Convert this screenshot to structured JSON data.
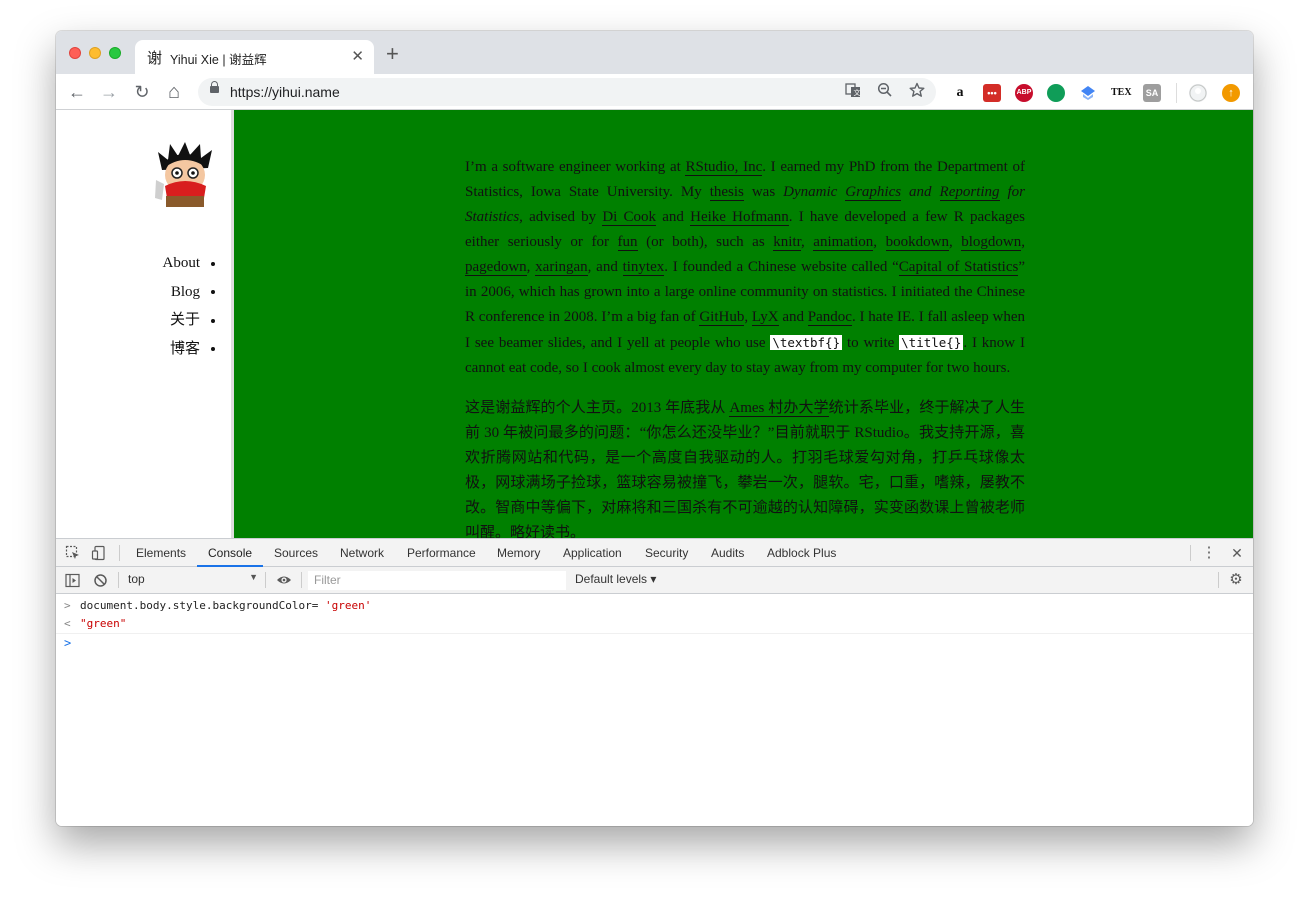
{
  "browser": {
    "tab": {
      "favicon_char": "谢",
      "title": "Yihui Xie | 谢益辉",
      "close": "✕"
    },
    "new_tab": "+",
    "url": "https://yihui.name",
    "nav": {
      "back": "←",
      "forward": "→",
      "reload": "↻",
      "home": "⌂"
    },
    "omnibox_icons": [
      "translate-icon",
      "zoom-out-icon",
      "star-icon"
    ],
    "extensions": [
      {
        "name": "amazon-icon",
        "label": "a",
        "color": "#ffffff"
      },
      {
        "name": "lastpass-icon",
        "label": "•••",
        "color": "#d32d27"
      },
      {
        "name": "adblock-plus-icon",
        "label": "ABP",
        "color": "#c70d2c"
      },
      {
        "name": "hangouts-icon",
        "label": "",
        "color": "#0f9d58"
      },
      {
        "name": "extension-blue-icon",
        "label": "",
        "color": "#4285f4"
      },
      {
        "name": "tex-icon",
        "label": "TEX",
        "color": "#ffffff"
      },
      {
        "name": "sa-icon",
        "label": "SA",
        "color": "#9e9e9e"
      },
      {
        "name": "profile-icon",
        "label": "",
        "color": "#e0e0e0"
      },
      {
        "name": "update-icon",
        "label": "↑",
        "color": "#f29900"
      }
    ]
  },
  "page": {
    "background": "#008000",
    "nav": [
      "About",
      "Blog",
      "关于",
      "博客"
    ],
    "p1": {
      "t1": "I’m a software engineer working at ",
      "rstudio": "RStudio, Inc",
      "t2": ". I earned my PhD from the Department of Statistics, Iowa State University. My ",
      "thesis": "thesis",
      "t3": " was ",
      "thesis_title_a": "Dynamic ",
      "graphics": "Graphics",
      "thesis_title_b": " and ",
      "reporting": "Reporting",
      "thesis_title_c": " for Statistics",
      "t4": ", advised by ",
      "dicook": "Di Cook",
      "t5": " and ",
      "heike": "Heike Hofmann",
      "t6": ". I have developed a few R packages either seriously or for ",
      "fun": "fun",
      "t7": " (or both), such as ",
      "knitr": "knitr",
      "animation": "animation",
      "bookdown": "bookdown",
      "blogdown": "blogdown",
      "pagedown": "pagedown",
      "xaringan": "xaringan",
      "t8": ", and ",
      "tinytex": "tinytex",
      "t9": ". I founded a Chinese website called “",
      "cos": "Capital of Statistics",
      "t10": "” in 2006, which has grown into a large online community on statistics. I initiated the Chinese R conference in 2008. I’m a big fan of ",
      "github": "GitHub",
      "lyx": "LyX",
      "t11": " and ",
      "pandoc": "Pandoc",
      "t12": ". I hate IE. I fall asleep when I see beamer slides, and I yell at people who use ",
      "code1": "\\textbf{}",
      "t13": " to write ",
      "code2": "\\title{}",
      "t14": ". I know I cannot eat code, so I cook almost every day to stay away from my computer for two hours."
    },
    "p2": {
      "t1": "这是谢益辉的个人主页。2013 年底我从 ",
      "ames": "Ames 村办大学",
      "t2": "统计系毕业，终于解决了人生前 30 年被问最多的问题：“你怎么还没毕业？”目前就职于 RStudio。我支持开源，喜欢折腾网站和代码，是一个高度自我驱动的人。打羽毛球爱勾对角，打乒乓球像太极，网球满场子捡球，篮球容易被撞飞，攀岩一次，腿软。宅，口重，嗜辣，屡教不改。智商中等偏下，对麻将和三国杀有不可逾越的认知障碍，实变函数课上曾被老师叫醒。略好读书。"
    }
  },
  "devtools": {
    "tabs": [
      "Elements",
      "Console",
      "Sources",
      "Network",
      "Performance",
      "Memory",
      "Application",
      "Security",
      "Audits",
      "Adblock Plus"
    ],
    "active_tab": "Console",
    "context": "top",
    "filter_placeholder": "Filter",
    "levels": "Default levels ▾",
    "console": {
      "input_code": "document.body.style.backgroundColor= ",
      "input_string": "'green'",
      "result": "\"green\"",
      "input_prefix": ">",
      "result_prefix": "<",
      "prompt": ">"
    }
  }
}
